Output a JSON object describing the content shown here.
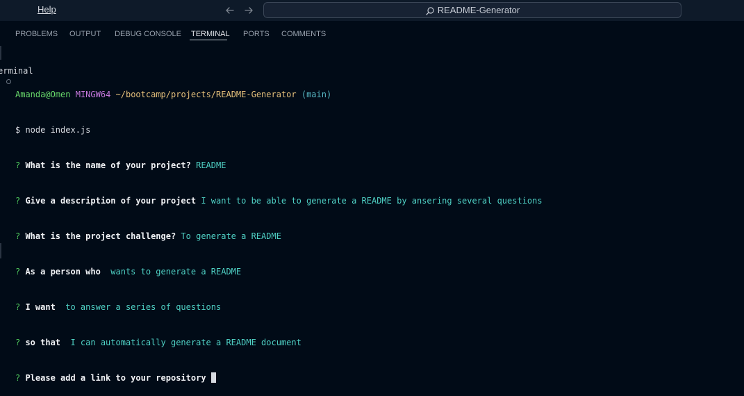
{
  "titlebar": {
    "menu_terminal": "erminal",
    "menu_help": "Help",
    "back_icon": "arrow-left-icon",
    "forward_icon": "arrow-right-icon",
    "search_label": "README-Generator"
  },
  "panel": {
    "tabs": [
      {
        "label": "PROBLEMS"
      },
      {
        "label": "OUTPUT"
      },
      {
        "label": "DEBUG CONSOLE"
      },
      {
        "label": "TERMINAL"
      },
      {
        "label": "PORTS"
      },
      {
        "label": "COMMENTS"
      }
    ],
    "active_tab": "TERMINAL"
  },
  "terminal": {
    "prompt": {
      "user": "Amanda@Omen",
      "host": "MINGW64",
      "path": "~/bootcamp/projects/README-Generator",
      "branch": "(main)"
    },
    "command": "$ node index.js",
    "qa": [
      {
        "q": "? ",
        "question": "What is the name of your project? ",
        "answer": "README"
      },
      {
        "q": "? ",
        "question": "Give a description of your project ",
        "answer": "I want to be able to generate a README by ansering several questions"
      },
      {
        "q": "? ",
        "question": "What is the project challenge? ",
        "answer": "To generate a README"
      },
      {
        "q": "? ",
        "question": "As a person who  ",
        "answer": "wants to generate a README"
      },
      {
        "q": "? ",
        "question": "I want  ",
        "answer": "to answer a series of questions"
      },
      {
        "q": "? ",
        "question": "so that  ",
        "answer": "I can automatically generate a README document"
      },
      {
        "q": "? ",
        "question": "Please add a link to your repository ",
        "answer": ""
      }
    ]
  },
  "colors": {
    "background": "#010b17",
    "titlebar": "#0e1a29",
    "prompt_user": "#68d96b",
    "prompt_host": "#c678dd",
    "prompt_path": "#e5c07b",
    "prompt_branch": "#56b6c2",
    "answer": "#4fd1c5"
  }
}
